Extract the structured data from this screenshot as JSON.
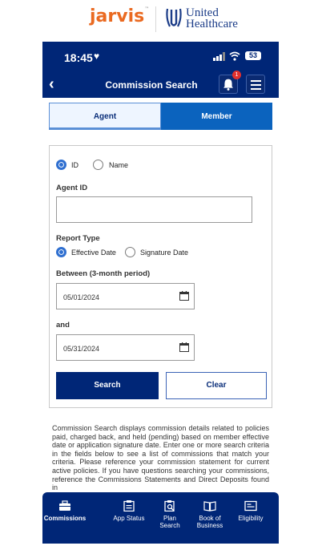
{
  "brand": {
    "jarvis": "jarvis",
    "jarvis_mark": "™",
    "uhc_line1": "United",
    "uhc_line2": "Healthcare"
  },
  "status_bar": {
    "time": "18:45",
    "battery": "53"
  },
  "nav": {
    "title": "Commission Search",
    "notification_count": "1"
  },
  "tabs": [
    {
      "label": "Agent",
      "selected": true
    },
    {
      "label": "Member",
      "selected": false
    }
  ],
  "form": {
    "search_by": {
      "options": [
        "ID",
        "Name"
      ],
      "selected": "ID"
    },
    "agent_id_label": "Agent ID",
    "agent_id_value": "",
    "report_type_label": "Report Type",
    "report_type": {
      "options": [
        "Effective Date",
        "Signature Date"
      ],
      "selected": "Effective Date"
    },
    "between_label": "Between (3-month period)",
    "start_date": "05/01/2024",
    "and_label": "and",
    "end_date": "05/31/2024",
    "search_button": "Search",
    "clear_button": "Clear"
  },
  "description": "Commission Search displays commission details related to policies paid, charged back, and held (pending) based on member effective date or application signature date. Enter one or more search criteria in the fields below to see a list of commissions that match your criteria. Please reference your commission statement for current active policies. If you have questions searching your commissions, reference the Commissions Statements and Direct Deposits found in",
  "bottom_nav": [
    {
      "label": "Commissions",
      "icon": "briefcase-icon",
      "active": true
    },
    {
      "label": "App Status",
      "icon": "clipboard-icon",
      "active": false
    },
    {
      "label": "Plan Search",
      "icon": "plan-search-icon",
      "active": false
    },
    {
      "label": "Book of Business",
      "icon": "book-icon",
      "active": false
    },
    {
      "label": "Eligibility",
      "icon": "id-card-icon",
      "active": false
    }
  ],
  "colors": {
    "brand_navy": "#002677",
    "tab_blue": "#0b63be",
    "jarvis_orange": "#ea6a21",
    "radio_blue": "#2f6fd0"
  }
}
